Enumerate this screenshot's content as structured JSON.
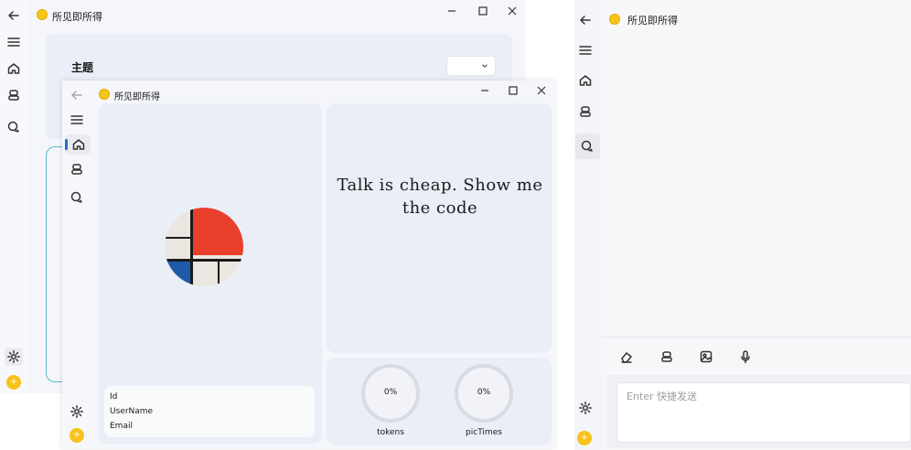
{
  "app": {
    "title": "所见即所得"
  },
  "settings_window": {
    "section_title": "主题"
  },
  "home_window": {
    "quote": "Talk is cheap. Show me the code",
    "user_fields": [
      "Id",
      "UserName",
      "Email"
    ],
    "stats": [
      {
        "label": "tokens",
        "value": "0%",
        "fraction": 0
      },
      {
        "label": "picTimes",
        "value": "0%",
        "fraction": 0
      }
    ]
  },
  "chat_window": {
    "input_placeholder": "Enter 快捷发送",
    "toolbar_icons": [
      "eraser-icon",
      "robot-icon",
      "image-icon",
      "microphone-icon"
    ]
  },
  "icons": {
    "back": "arrow-left-icon",
    "menu": "hamburger-menu-icon",
    "home": "home-icon",
    "bot": "robot-icon",
    "chat": "chat-icon",
    "settings": "gear-icon",
    "add": "plus-icon"
  },
  "colors": {
    "accent": "#f8c21a",
    "panel": "#eef1f8",
    "sidebar": "#f6f7fb",
    "window_bg": "#f5f7fc",
    "ring": "#d8dbe3",
    "mondrian_red": "#e8402c",
    "mondrian_blue": "#1f5aa8"
  }
}
